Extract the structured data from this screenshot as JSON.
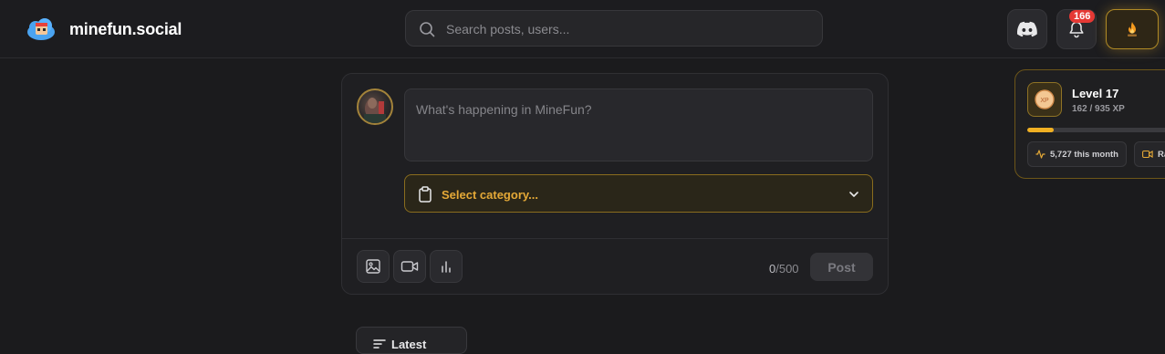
{
  "header": {
    "brand": "minefun.social",
    "search_placeholder": "Search posts, users...",
    "notification_count": "166",
    "icons": {
      "logo": "cloud-logo-icon",
      "search": "search-icon",
      "discord": "discord-icon",
      "bell": "bell-icon",
      "profile": "flame-icon"
    }
  },
  "composer": {
    "placeholder": "What's happening in MineFun?",
    "category_label": "Select category...",
    "char_current": "0",
    "char_max": "/500",
    "post_label": "Post",
    "media_icons": [
      "image-icon",
      "video-icon",
      "poll-icon"
    ]
  },
  "level_card": {
    "level": "Level 17",
    "xp": "162 / 935 XP",
    "progress_fraction": 0.17,
    "monthly": "5,727 this month",
    "second_chip": "Ra",
    "xp_badge": "XP"
  },
  "feed": {
    "filter_label": "Latest"
  },
  "colors": {
    "accent": "#f0b023",
    "background": "#1b1b1d",
    "badge": "#e53935",
    "category_text": "#e5a937"
  }
}
